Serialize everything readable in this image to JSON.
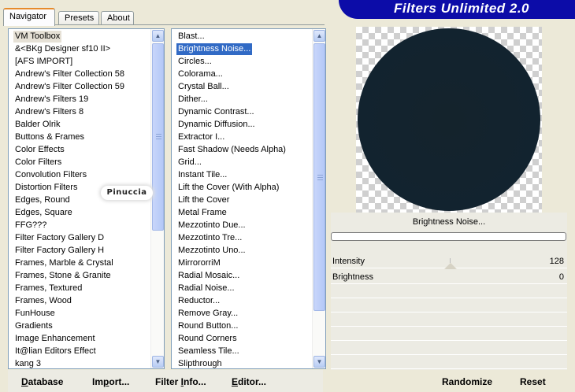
{
  "tabs": [
    {
      "label": "Navigator",
      "active": true
    },
    {
      "label": "Presets",
      "active": false
    },
    {
      "label": "About",
      "active": false
    }
  ],
  "banner": {
    "title": "Filters Unlimited 2.0",
    "color": "#0c0ca8"
  },
  "categories": {
    "selected": "VM Toolbox",
    "items": [
      "VM Toolbox",
      "&<BKg Designer sf10 II>",
      "[AFS IMPORT]",
      "Andrew's Filter Collection 58",
      "Andrew's Filter Collection 59",
      "Andrew's Filters 19",
      "Andrew's Filters 8",
      "Balder Olrik",
      "Buttons & Frames",
      "Color Effects",
      "Color Filters",
      "Convolution Filters",
      "Distortion Filters",
      "Edges, Round",
      "Edges, Square",
      "FFG???",
      "Filter Factory Gallery D",
      "Filter Factory Gallery H",
      "Frames, Marble & Crystal",
      "Frames, Stone & Granite",
      "Frames, Textured",
      "Frames, Wood",
      "FunHouse",
      "Gradients",
      "Image Enhancement",
      "It@lian Editors Effect",
      "kang 3"
    ]
  },
  "filters": {
    "selected": "Brightness Noise...",
    "items": [
      "Blast...",
      "Brightness Noise...",
      "Circles...",
      "Colorama...",
      "Crystal Ball...",
      "Dither...",
      "Dynamic Contrast...",
      "Dynamic Diffusion...",
      "Extractor I...",
      "Fast Shadow (Needs Alpha)",
      "Grid...",
      "Instant Tile...",
      "Lift the Cover (With Alpha)",
      "Lift the Cover",
      "Metal Frame",
      "Mezzotinto Due...",
      "Mezzotinto Tre...",
      "Mezzotinto Uno...",
      "MirrororriM",
      "Radial Mosaic...",
      "Radial Noise...",
      "Reductor...",
      "Remove Gray...",
      "Round Button...",
      "Round Corners",
      "Seamless Tile...",
      "Slipthrough"
    ]
  },
  "preview": {
    "filter_name": "Brightness Noise...",
    "shape": "dark-circle"
  },
  "parameters": [
    {
      "name": "Intensity",
      "value": "128"
    },
    {
      "name": "Brightness",
      "value": "0"
    }
  ],
  "buttons": {
    "database": {
      "label_u": "D",
      "label_rest": "atabase"
    },
    "import": {
      "label_pre": "Im",
      "label_u": "p",
      "label_rest": "ort..."
    },
    "filter_info": {
      "label_pre": "Filter ",
      "label_u": "I",
      "label_rest": "nfo..."
    },
    "editor": {
      "label_u": "E",
      "label_rest": "ditor..."
    },
    "randomize": {
      "label": "Randomize"
    },
    "reset": {
      "label": "Reset"
    }
  },
  "watermark": {
    "text": "Pinuccia"
  }
}
